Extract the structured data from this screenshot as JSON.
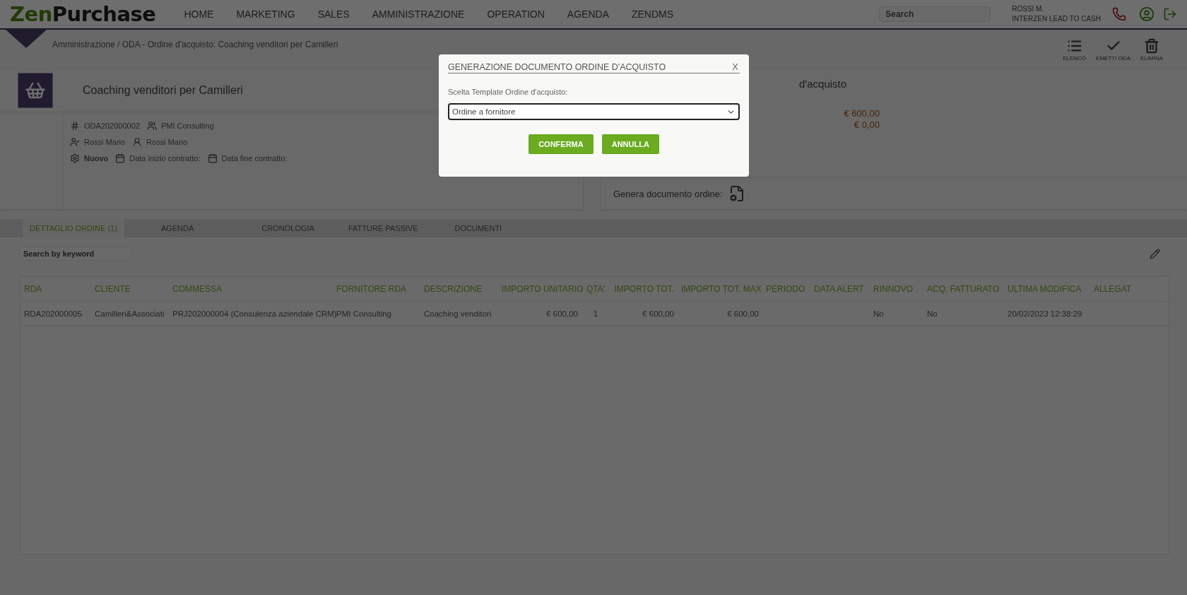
{
  "header": {
    "logo": {
      "first": "Zen",
      "second": "Purchase"
    },
    "menu": [
      {
        "label": "HOME"
      },
      {
        "label": "MARKETING"
      },
      {
        "label": "SALES"
      },
      {
        "label": "AMMINISTRAZIONE"
      },
      {
        "label": "OPERATION"
      },
      {
        "label": "AGENDA"
      },
      {
        "label": "ZENDMS"
      }
    ],
    "search": {
      "placeholder": "Search"
    },
    "user": {
      "name": "ROSSI M.",
      "company": "INTERZEN LEAD TO CASH"
    }
  },
  "breadcrumb": "Amministrazione / ODA - Ordine d'acquisto: Coaching venditori per Camilleri",
  "toolbar": [
    {
      "kind": "list",
      "label": "ELENCO"
    },
    {
      "kind": "check",
      "label": "EMETTI ODA"
    },
    {
      "kind": "trash",
      "label": "ELIMINA"
    }
  ],
  "order_card": {
    "title": "Coaching venditori per Camilleri",
    "lines": [
      [
        {
          "kind": "number",
          "text": "ODA202000002"
        },
        {
          "kind": "supplier",
          "text": "PMI Consulting"
        }
      ],
      [
        {
          "kind": "user",
          "text": "Rossi Mario"
        },
        {
          "kind": "user2",
          "text": "Rossi Mario"
        }
      ],
      [
        {
          "kind": "status",
          "text": "Nuovo"
        },
        {
          "kind": "calendar",
          "text": "Data inizio contratto:"
        },
        {
          "kind": "calendar",
          "text": "Data fine contratto:"
        }
      ]
    ]
  },
  "summary_card": {
    "title": "d'acquisto",
    "amounts": [
      "€ 600,00",
      "€ 0,00"
    ],
    "generate_label": "Genera documento ordine:"
  },
  "tabs": [
    {
      "label": "DETTAGLIO ORDINE (1)",
      "selected": true
    },
    {
      "label": "AGENDA",
      "selected": false
    },
    {
      "label": "CRONOLOGIA",
      "selected": false
    },
    {
      "label": "FATTURE PASSIVE",
      "selected": false
    },
    {
      "label": "DOCUMENTI",
      "selected": false
    }
  ],
  "table_search": {
    "placeholder": "Search by keyword"
  },
  "table": {
    "columns": [
      {
        "label": "RDA",
        "kind": "text"
      },
      {
        "label": "CLIENTE",
        "kind": "text"
      },
      {
        "label": "COMMESSA",
        "kind": "text"
      },
      {
        "label": "FORNITORE RDA",
        "kind": "text"
      },
      {
        "label": "DESCRIZIONE",
        "kind": "text"
      },
      {
        "label": "IMPORTO UNITARIO",
        "kind": "amount"
      },
      {
        "label": "QTA'",
        "kind": "count"
      },
      {
        "label": "IMPORTO TOT.",
        "kind": "amount"
      },
      {
        "label": "IMPORTO TOT. MAX",
        "kind": "amount"
      },
      {
        "label": "PERIODO",
        "kind": "text"
      },
      {
        "label": "DATA ALERT",
        "kind": "text"
      },
      {
        "label": "RINNOVO",
        "kind": "text"
      },
      {
        "label": "ACQ. FATTURATO",
        "kind": "text"
      },
      {
        "label": "ULTIMA MODIFICA",
        "kind": "text"
      },
      {
        "label": "ALLEGAT",
        "kind": "text"
      }
    ],
    "rows": [
      {
        "cells": [
          "RDA202000005",
          "Camilleri&Associati",
          "PRJ202000004 (Consulenza aziendale CRM)",
          "PMI Consulting",
          "Coaching venditori",
          "€ 600,00",
          "1",
          "€ 600,00",
          "€ 600,00",
          null,
          null,
          "No",
          "No",
          "20/02/2023 12:38:29",
          null
        ]
      }
    ]
  },
  "dialog": {
    "title": "GENERAZIONE DOCUMENTO ORDINE D'ACQUISTO",
    "close": "X",
    "field_label": "Scelta Template Ordine d'acquisto:",
    "select_value": "Ordine a fornitore",
    "buttons": [
      "CONFERMA",
      "ANNULLA"
    ]
  }
}
